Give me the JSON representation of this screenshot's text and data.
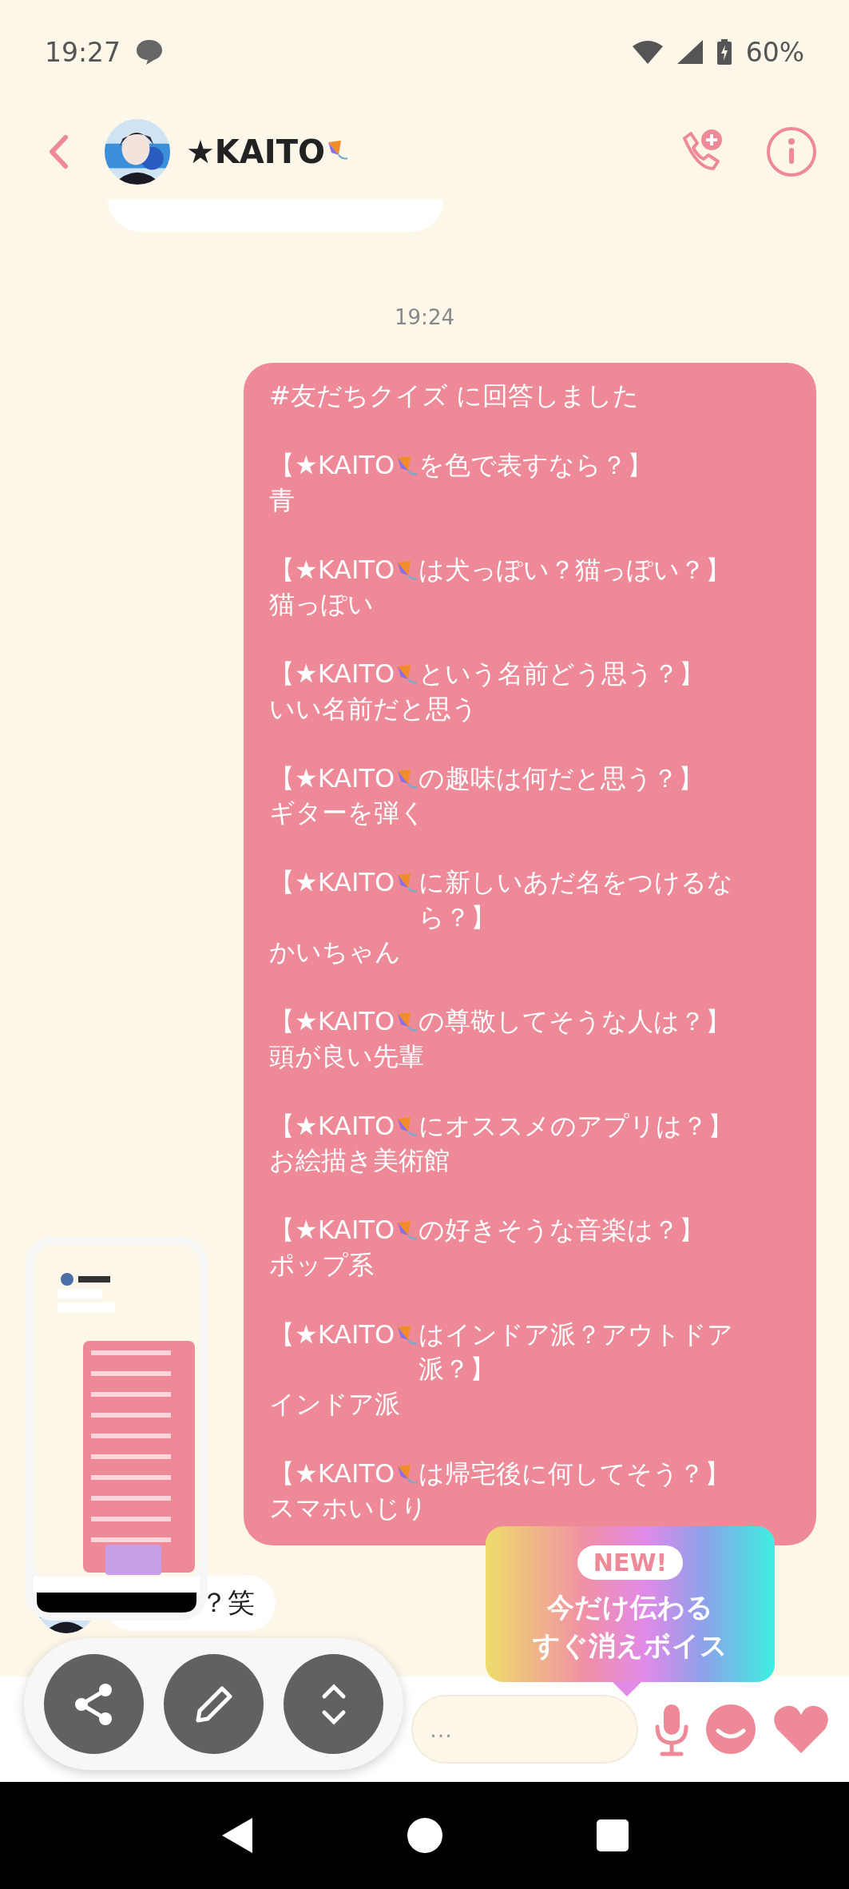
{
  "status_bar": {
    "time": "19:27",
    "battery": "60%"
  },
  "header": {
    "contact_name": "★KAITO"
  },
  "timestamp": "19:24",
  "quiz": {
    "intro": "#友だちクイズ に回答しました",
    "items": [
      {
        "lead": "【★KAITO",
        "question": "を色で表すなら？】",
        "answer": "青"
      },
      {
        "lead": "【★KAITO",
        "question": "は犬っぽい？猫っぽい？】",
        "answer": "猫っぽい"
      },
      {
        "lead": "【★KAITO",
        "question": "という名前どう思う？】",
        "answer": "いい名前だと思う"
      },
      {
        "lead": "【★KAITO",
        "question": "の趣味は何だと思う？】",
        "answer": "ギターを弾く"
      },
      {
        "lead": "【★KAITO",
        "question": "に新しいあだ名をつけるなら？】",
        "answer": "かいちゃん"
      },
      {
        "lead": "【★KAITO",
        "question": "の尊敬してそうな人は？】",
        "answer": "頭が良い先輩"
      },
      {
        "lead": "【★KAITO",
        "question": "にオススメのアプリは？】",
        "answer": "お絵描き美術館"
      },
      {
        "lead": "【★KAITO",
        "question": "の好きそうな音楽は？】",
        "answer": "ポップ系"
      },
      {
        "lead": "【★KAITO",
        "question": "はインドア派？アウトドア派？】",
        "answer": "インドア派"
      },
      {
        "lead": "【★KAITO",
        "question": "は帰宅後に何してそう？】",
        "answer": "スマホいじり"
      }
    ]
  },
  "reply": {
    "text": "？笑"
  },
  "input": {
    "placeholder": "…"
  },
  "tooltip": {
    "badge": "NEW!",
    "lines": [
      "今だけ伝わる",
      "すぐ消えボイス"
    ]
  }
}
